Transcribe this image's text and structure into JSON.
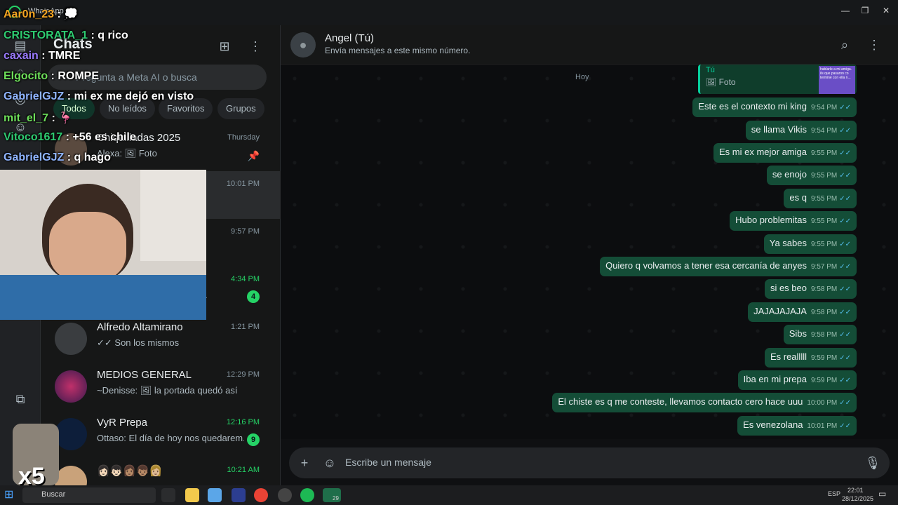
{
  "window": {
    "title": "WhatsApp",
    "minimize": "—",
    "maximize": "❐",
    "close": "✕"
  },
  "chatlist": {
    "title": "Chats",
    "search_placeholder": "Pregunta a Meta AI o busca",
    "filters": [
      "Todos",
      "No leídos",
      "Favoritos",
      "Grupos"
    ],
    "rows": [
      {
        "name": "Chiquilladas 2025",
        "preview": "Alexa: 🖼 Foto",
        "time": "Thursday",
        "time_green": false,
        "badge": "",
        "pinned": "📌"
      },
      {
        "name": "",
        "preview": "",
        "time": "10:01 PM",
        "time_green": false,
        "badge": ""
      },
      {
        "name": "",
        "preview": "",
        "time": "9:57 PM",
        "time_green": false,
        "badge": ""
      },
      {
        "name": "",
        "preview": "ora",
        "time": "4:34 PM",
        "time_green": true,
        "badge": "4"
      },
      {
        "name": "Alfredo Altamirano",
        "preview": "✓✓ Son los mismos",
        "time": "1:21 PM",
        "time_green": false,
        "badge": ""
      },
      {
        "name": "MEDIOS GENERAL",
        "preview": "~Denisse: 🖼 la portada quedó así",
        "time": "12:29 PM",
        "time_green": false,
        "badge": ""
      },
      {
        "name": "VyR Prepa",
        "preview": "Ottaso: El día de hoy nos quedarem...",
        "time": "12:16 PM",
        "time_green": true,
        "badge": "9"
      },
      {
        "name": "👩🏻👦🏻👩🏽👦🏽👩🏼",
        "preview": "",
        "time": "10:21 AM",
        "time_green": true,
        "badge": ""
      }
    ]
  },
  "conversation": {
    "title": "Angel (Tú)",
    "subtitle": "Envía mensajes a este mismo número.",
    "day_label": "Hoy",
    "quote": {
      "who": "Tú",
      "what": "🖼 Foto",
      "thumb_text": "hablarle a mi amiga. ils que pasaron co terminé con ella n..."
    },
    "messages": [
      {
        "text": "Este es el contexto mi king",
        "time": "9:54 PM"
      },
      {
        "text": "se llama Vikis",
        "time": "9:54 PM"
      },
      {
        "text": "Es mi ex mejor amiga",
        "time": "9:55 PM"
      },
      {
        "text": "se enojo",
        "time": "9:55 PM"
      },
      {
        "text": "es q",
        "time": "9:55 PM"
      },
      {
        "text": "Hubo problemitas",
        "time": "9:55 PM"
      },
      {
        "text": "Ya sabes",
        "time": "9:55 PM"
      },
      {
        "text": "Quiero q volvamos a tener esa cercanía de anyes",
        "time": "9:57 PM"
      },
      {
        "text": "si es beo",
        "time": "9:58 PM"
      },
      {
        "text": "JAJAJAJAJA",
        "time": "9:58 PM"
      },
      {
        "text": "Sibs",
        "time": "9:58 PM"
      },
      {
        "text": "Es realllll",
        "time": "9:59 PM"
      },
      {
        "text": "Iba en mi prepa",
        "time": "9:59 PM"
      },
      {
        "text": "El chiste es q me conteste, llevamos contacto cero hace uuu",
        "time": "10:00 PM"
      },
      {
        "text": "Es venezolana",
        "time": "10:01 PM"
      }
    ],
    "composer_placeholder": "Escribe un mensaje",
    "check_mark": "✓✓"
  },
  "stream_chat": [
    {
      "user": "Aar0n_23",
      "msg": " : 💭",
      "color": "#f5a623"
    },
    {
      "user": "CRISTORATA_1",
      "msg": " : q rico",
      "color": "#2ecc71"
    },
    {
      "user": "caxain",
      "msg": " : TMRE",
      "color": "#9b7bff"
    },
    {
      "user": "Elgocito",
      "msg": " : ROMPE",
      "color": "#6ee05a"
    },
    {
      "user": "GabrielGJZ",
      "msg": " : mi ex me dejó en visto",
      "color": "#8fb4ff"
    },
    {
      "user": "mit_el_7",
      "msg": " : 🦩",
      "color": "#6ee05a"
    },
    {
      "user": "Vitoco1617",
      "msg": " : +56 es chile",
      "color": "#2ecc71"
    },
    {
      "user": "GabrielGJZ",
      "msg": " : q hago",
      "color": "#8fb4ff"
    }
  ],
  "overlay": {
    "multiplier": "x5"
  },
  "taskbar": {
    "search_label": "Buscar",
    "whatsapp_badge": "29",
    "lang": "ESP",
    "time": "22:01",
    "date": "28/12/2025"
  },
  "colors": {
    "accent": "#25d366",
    "bubble_out": "#144d37",
    "read_check": "#53bdeb"
  }
}
